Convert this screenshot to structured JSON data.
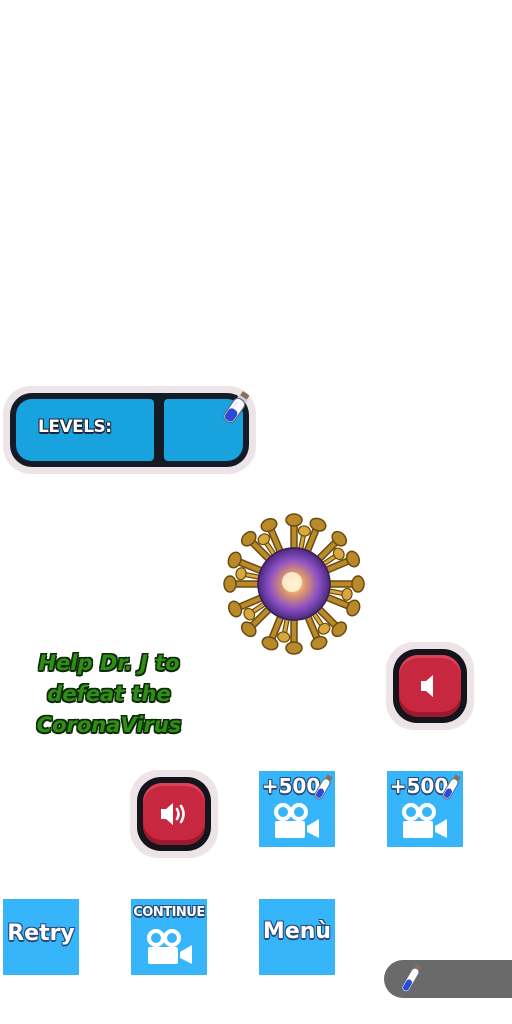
{
  "levels_panel": {
    "label": "LEVELS:"
  },
  "tagline": {
    "line1": "Help Dr. J to",
    "line2": "defeat the",
    "line3": "CoronaVirus"
  },
  "buttons": {
    "reward1_label": "+500",
    "reward2_label": "+500",
    "retry_label": "Retry",
    "continue_label": "CONTINUE",
    "menu_label": "Menù"
  },
  "icons": {
    "mute": "speaker-mute-icon",
    "sound": "speaker-sound-icon",
    "video": "video-camera-icon",
    "vial": "vaccine-vial-icon",
    "virus": "coronavirus-icon"
  },
  "colors": {
    "panel_blue": "#19a3de",
    "button_blue": "#37b5fb",
    "sound_red": "#c8283f",
    "tagline_green": "#2f8e16",
    "vial_bar_gray": "#6b6a6b"
  }
}
